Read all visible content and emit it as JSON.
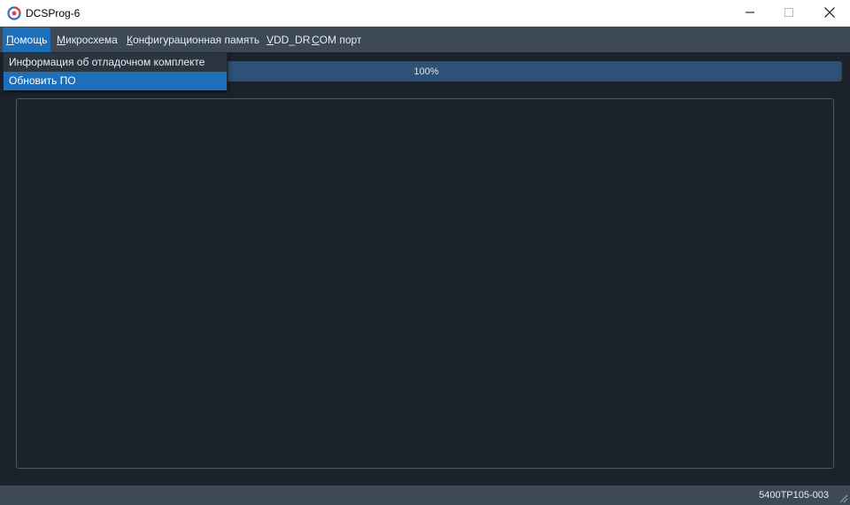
{
  "window": {
    "title": "DCSProg-6",
    "app_icon": "dcsprog-logo-icon",
    "controls": [
      "minimize-icon",
      "maximize-icon",
      "close-icon"
    ]
  },
  "menubar": {
    "items": [
      {
        "mnemonic": "П",
        "rest": "омощь",
        "open": true
      },
      {
        "mnemonic": "М",
        "rest": "икросхема",
        "open": false
      },
      {
        "mnemonic": "К",
        "rest": "онфигурационная память",
        "open": false
      },
      {
        "mnemonic": "V",
        "rest": "DD_DR",
        "open": false
      },
      {
        "mnemonic": "C",
        "rest": "OM порт",
        "open": false
      }
    ]
  },
  "dropdown": {
    "items": [
      {
        "label": "Информация об отладочном комплекте",
        "highlighted": false
      },
      {
        "label": "Обновить ПО",
        "highlighted": true
      }
    ]
  },
  "progress": {
    "value": 100,
    "label": "100%"
  },
  "log": {
    "text": ""
  },
  "statusbar": {
    "chip": "5400ТР105-003"
  },
  "colors": {
    "background": "#1b222b",
    "menubar": "#3d4a56",
    "highlight": "#1c6fb8",
    "progress_fill": "#2e5277"
  }
}
